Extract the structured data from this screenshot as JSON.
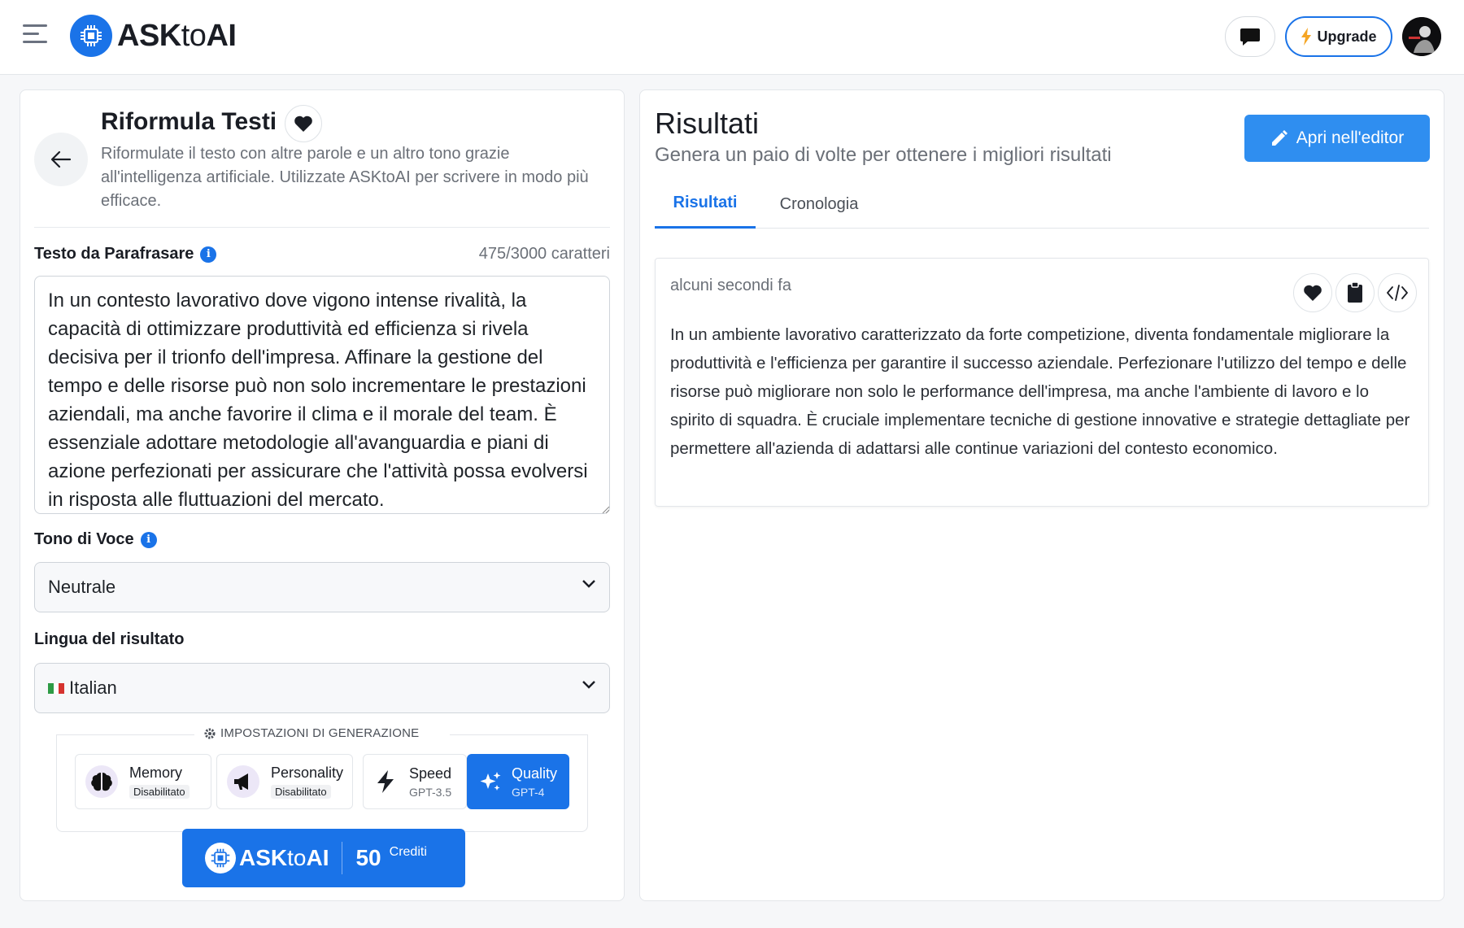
{
  "app": {
    "name": "ASKtoAI",
    "name_prefix": "ASK",
    "name_to": "to",
    "name_suffix": "AI"
  },
  "header": {
    "upgrade_label": "Upgrade"
  },
  "tool": {
    "title": "Riformula Testi",
    "description": "Riformulate il testo con altre parole e un altro tono grazie all'intelligenza artificiale. Utilizzate ASKtoAI per scrivere in modo più efficace."
  },
  "input": {
    "label": "Testo da Parafrasare",
    "char_count": "475/3000 caratteri",
    "text": "In un contesto lavorativo dove vigono intense rivalità, la capacità di ottimizzare produttività ed efficienza si rivela decisiva per il trionfo dell'impresa. Affinare la gestione del tempo e delle risorse può non solo incrementare le prestazioni aziendali, ma anche favorire il clima e il morale del team. È essenziale adottare metodologie all'avanguardia e piani di azione perfezionati per assicurare che l'attività possa evolversi in risposta alle fluttuazioni del mercato."
  },
  "tone": {
    "label": "Tono di Voce",
    "selected": "Neutrale"
  },
  "language": {
    "label": "Lingua del risultato",
    "selected": "Italian"
  },
  "generation": {
    "title": "IMPOSTAZIONI DI GENERAZIONE",
    "memory": {
      "label": "Memory",
      "status": "Disabilitato"
    },
    "personality": {
      "label": "Personality",
      "status": "Disabilitato"
    },
    "speed": {
      "label": "Speed",
      "model": "GPT-3.5"
    },
    "quality": {
      "label": "Quality",
      "model": "GPT-4"
    }
  },
  "submit": {
    "credits": "50",
    "credits_label": "Crediti"
  },
  "results": {
    "title": "Risultati",
    "subtitle": "Genera un paio di volte per ottenere i migliori risultati",
    "open_editor": "Apri nell'editor",
    "tabs": [
      "Risultati",
      "Cronologia"
    ],
    "card": {
      "time": "alcuni secondi fa",
      "text": "In un ambiente lavorativo caratterizzato da forte competizione, diventa fondamentale migliorare la produttività e l'efficienza per garantire il successo aziendale. Perfezionare l'utilizzo del tempo e delle risorse può migliorare non solo le performance dell'impresa, ma anche l'ambiente di lavoro e lo spirito di squadra. È cruciale implementare tecniche di gestione innovative e strategie dettagliate per permettere all'azienda di adattarsi alle continue variazioni del contesto economico."
    }
  },
  "colors": {
    "primary": "#1a73e8",
    "editor_button": "#2f8ef0"
  }
}
